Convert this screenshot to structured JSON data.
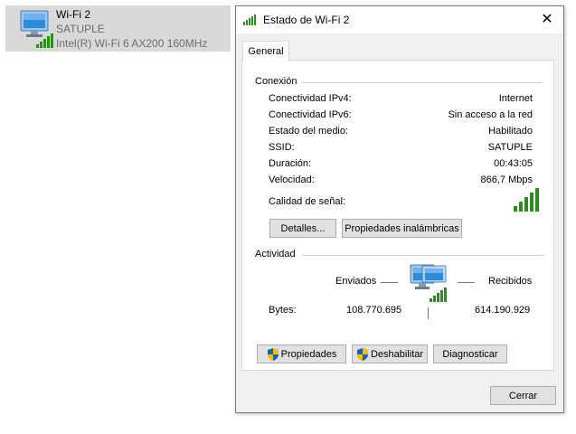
{
  "adapter": {
    "name": "Wi-Fi 2",
    "ssid": "SATUPLE",
    "device": "Intel(R) Wi-Fi 6 AX200 160MHz"
  },
  "dialog": {
    "title": "Estado de Wi-Fi 2",
    "close_glyph": "✕",
    "tab_general": "General",
    "connection": {
      "header": "Conexión",
      "rows": [
        {
          "label": "Conectividad IPv4:",
          "value": "Internet"
        },
        {
          "label": "Conectividad IPv6:",
          "value": "Sin acceso a la red"
        },
        {
          "label": "Estado del medio:",
          "value": "Habilitado"
        },
        {
          "label": "SSID:",
          "value": "SATUPLE"
        },
        {
          "label": "Duración:",
          "value": "00:43:05"
        },
        {
          "label": "Velocidad:",
          "value": "866,7 Mbps"
        }
      ],
      "signal_label": "Calidad de señal:",
      "signal_bars": 5,
      "details_button": "Detalles...",
      "wireless_props_button": "Propiedades inalámbricas"
    },
    "activity": {
      "header": "Actividad",
      "sent_label": "Enviados",
      "received_label": "Recibidos",
      "bytes_label": "Bytes:",
      "bytes_sent": "108.770.695",
      "bytes_received": "614.190.929"
    },
    "properties_button": "Propiedades",
    "disable_button": "Deshabilitar",
    "diagnose_button": "Diagnosticar",
    "close_button": "Cerrar"
  },
  "colors": {
    "signal_green": "#2e8b1f",
    "monitor_blue": "#2f8ad8",
    "shield_blue": "#1e5cb3",
    "shield_yellow": "#f2c200"
  }
}
